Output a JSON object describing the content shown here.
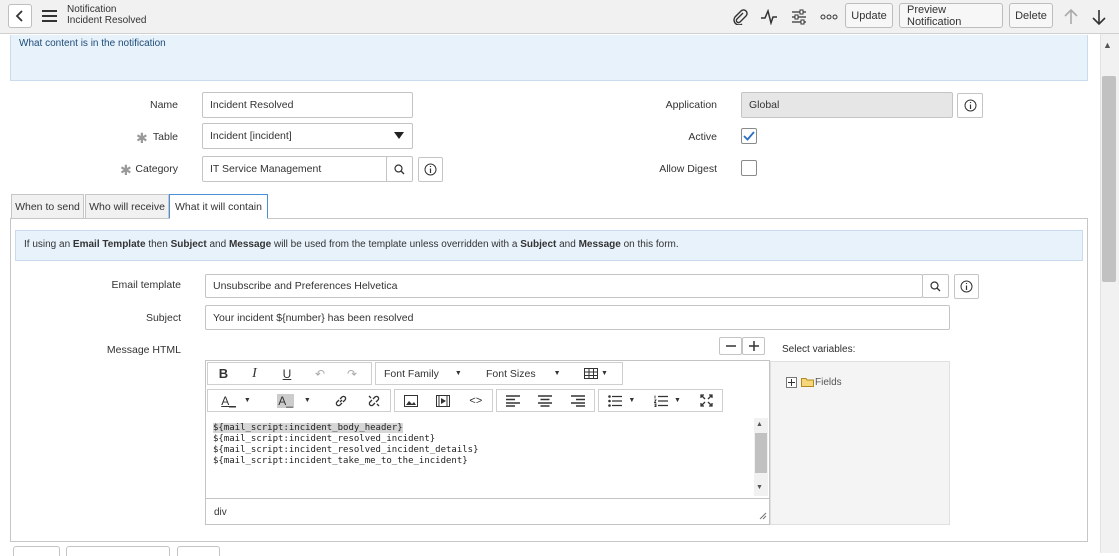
{
  "header": {
    "title_line1": "Notification",
    "title_line2": "Incident Resolved",
    "buttons": {
      "update": "Update",
      "preview": "Preview Notification",
      "delete": "Delete"
    },
    "icons": [
      "attachment-icon",
      "activity-icon",
      "settings-sliders-icon",
      "more-icon",
      "arrow-up-icon",
      "arrow-down-icon"
    ]
  },
  "section": {
    "info": "What content is in the notification"
  },
  "form": {
    "name_label": "Name",
    "name_value": "Incident Resolved",
    "table_label": "Table",
    "table_value": "Incident [incident]",
    "category_label": "Category",
    "category_value": "IT Service Management",
    "application_label": "Application",
    "application_value": "Global",
    "active_label": "Active",
    "active_checked": true,
    "allow_digest_label": "Allow Digest",
    "allow_digest_checked": false
  },
  "tabs": [
    {
      "label": "When to send",
      "active": false
    },
    {
      "label": "Who will receive",
      "active": false
    },
    {
      "label": "What it will contain",
      "active": true
    }
  ],
  "content": {
    "tip": {
      "p1": "If using an ",
      "b1": "Email Template",
      "p2": " then ",
      "b2": "Subject",
      "p3": " and ",
      "b3": "Message",
      "p4": " will be used from the template unless overridden with a ",
      "b4": "Subject",
      "p5": " and ",
      "b5": "Message",
      "p6": " on this form."
    },
    "email_template_label": "Email template",
    "email_template_value": "Unsubscribe and Preferences Helvetica",
    "subject_label": "Subject",
    "subject_value": "Your incident ${number} has been resolved",
    "message_label": "Message HTML",
    "select_variables_label": "Select variables:",
    "fields_label": "Fields",
    "editor": {
      "font_family": "Font Family",
      "font_sizes": "Font Sizes",
      "lines": [
        "${mail_script:incident_body_header}",
        "${mail_script:incident_resolved_incident}",
        "${mail_script:incident_resolved_incident_details}",
        "${mail_script:incident_take_me_to_the_incident}"
      ],
      "status_path": "div"
    }
  },
  "colors": {
    "accent": "#4a90d9",
    "info_bg": "#e8f2fb",
    "header_bg": "#f1f1f1"
  }
}
